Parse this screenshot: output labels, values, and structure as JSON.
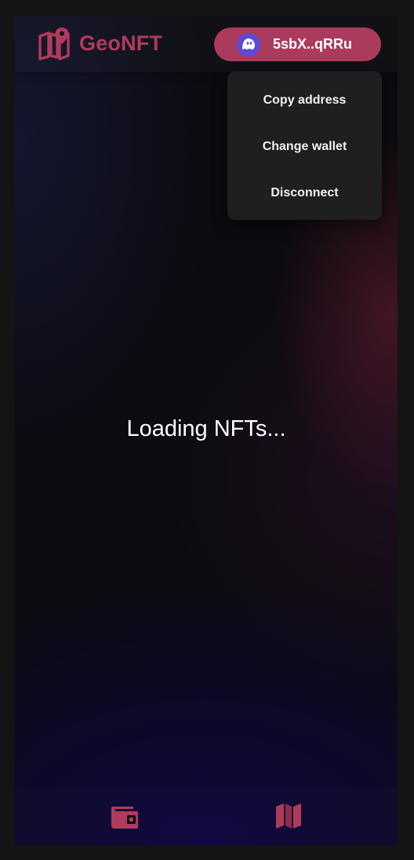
{
  "header": {
    "logo_text": "GeoNFT",
    "logo_icon": "map-pin-icon",
    "wallet_button": {
      "address": "5sbX..qRRu",
      "avatar_icon": "ghost-icon"
    }
  },
  "wallet_menu": {
    "items": [
      {
        "label": "Copy address"
      },
      {
        "label": "Change wallet"
      },
      {
        "label": "Disconnect"
      }
    ]
  },
  "main": {
    "status_text": "Loading NFTs..."
  },
  "bottom_nav": {
    "items": [
      {
        "icon": "wallet-icon"
      },
      {
        "icon": "map-icon"
      }
    ]
  },
  "colors": {
    "accent": "#ab3b5c",
    "logo": "#b13a5c",
    "avatar": "#5c4ad8",
    "menu_bg": "#1f1f21"
  }
}
